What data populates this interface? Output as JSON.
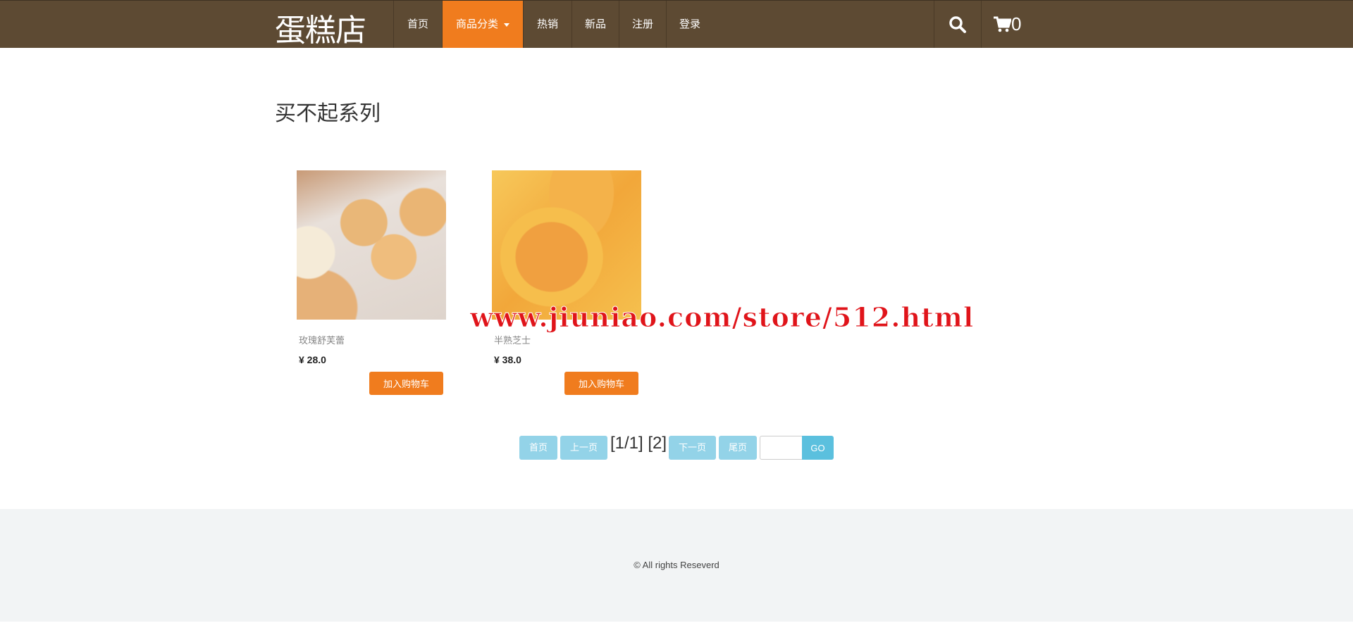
{
  "nav": {
    "logo": "蛋糕店",
    "items": [
      {
        "label": "首页"
      },
      {
        "label": "商品分类"
      },
      {
        "label": "热销"
      },
      {
        "label": "新品"
      },
      {
        "label": "注册"
      },
      {
        "label": "登录"
      }
    ],
    "cart_count": "0"
  },
  "page_title": "买不起系列",
  "products": [
    {
      "name": "玫瑰舒芙蕾",
      "price": "¥ 28.0",
      "button": "加入购物车"
    },
    {
      "name": "半熟芝士",
      "price": "¥ 38.0",
      "button": "加入购物车"
    }
  ],
  "pagination": {
    "first": "首页",
    "prev": "上一页",
    "info": "[1/1] [2]",
    "next": "下一页",
    "last": "尾页",
    "go": "GO",
    "input_value": ""
  },
  "footer": {
    "text": "© All rights Reseverd"
  },
  "watermark": "www.jiuniao.com/store/512.html",
  "colors": {
    "nav": "#5d4a33",
    "accent": "#f07c1e",
    "pager": "#93d3e8",
    "go": "#5bc0de"
  }
}
